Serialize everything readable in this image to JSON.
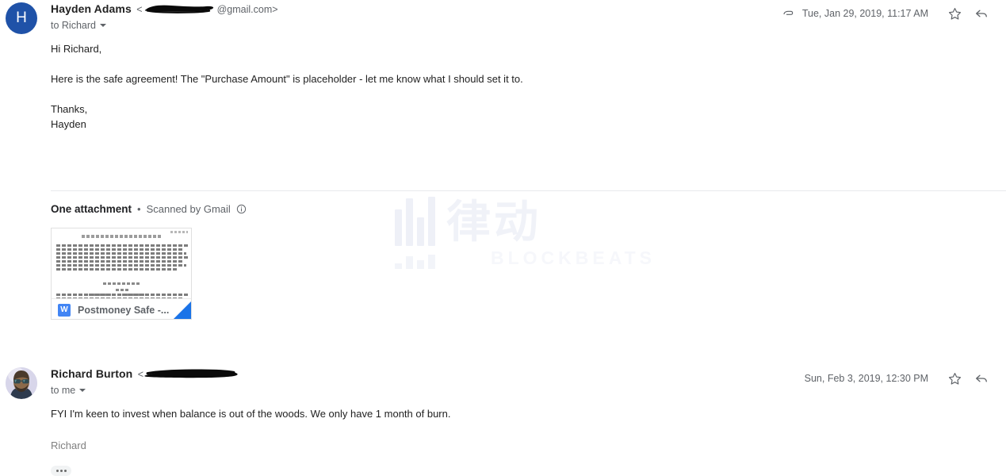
{
  "watermark": {
    "cn_text": "律动",
    "sub_text": "BLOCKBEATS"
  },
  "messages": [
    {
      "avatar": {
        "type": "letter",
        "letter": "H"
      },
      "sender_name": "Hayden Adams",
      "email_prefix": "<",
      "email_suffix": "@gmail.com>",
      "recipient": "to Richard",
      "has_attachment_icon": true,
      "date": "Tue, Jan 29, 2019, 11:17 AM",
      "star_label": "Star",
      "reply_label": "Reply",
      "body_lines": [
        "Hi Richard,",
        "",
        "Here is the safe agreement! The \"Purchase Amount\" is placeholder - let me know what I should set it to.",
        "",
        "Thanks,",
        "Hayden"
      ]
    },
    {
      "avatar": {
        "type": "photo",
        "letter": ""
      },
      "sender_name": "Richard Burton",
      "email_prefix": "<",
      "email_suffix": "",
      "recipient": "to me",
      "has_attachment_icon": false,
      "date": "Sun, Feb 3, 2019, 12:30 PM",
      "star_label": "Star",
      "reply_label": "Reply",
      "body_lines": [
        "FYI I'm keen to invest when balance is out of the woods. We only have 1 month of burn."
      ],
      "signature": "Richard",
      "trimmed_label": "Show trimmed content"
    }
  ],
  "attachment_section": {
    "heading": "One attachment",
    "separator": "•",
    "scanned_text": "Scanned by Gmail",
    "info_icon": "info-icon",
    "file": {
      "name": "Postmoney Safe -...",
      "type_badge": "W",
      "doc_heading": "POST MONEY VALUATION CAP"
    }
  },
  "colors": {
    "avatar_blue": "#1f52a8",
    "word_blue": "#4285f4",
    "fold_blue": "#1a73e8",
    "text_primary": "#222222",
    "text_secondary": "#5f6368"
  }
}
